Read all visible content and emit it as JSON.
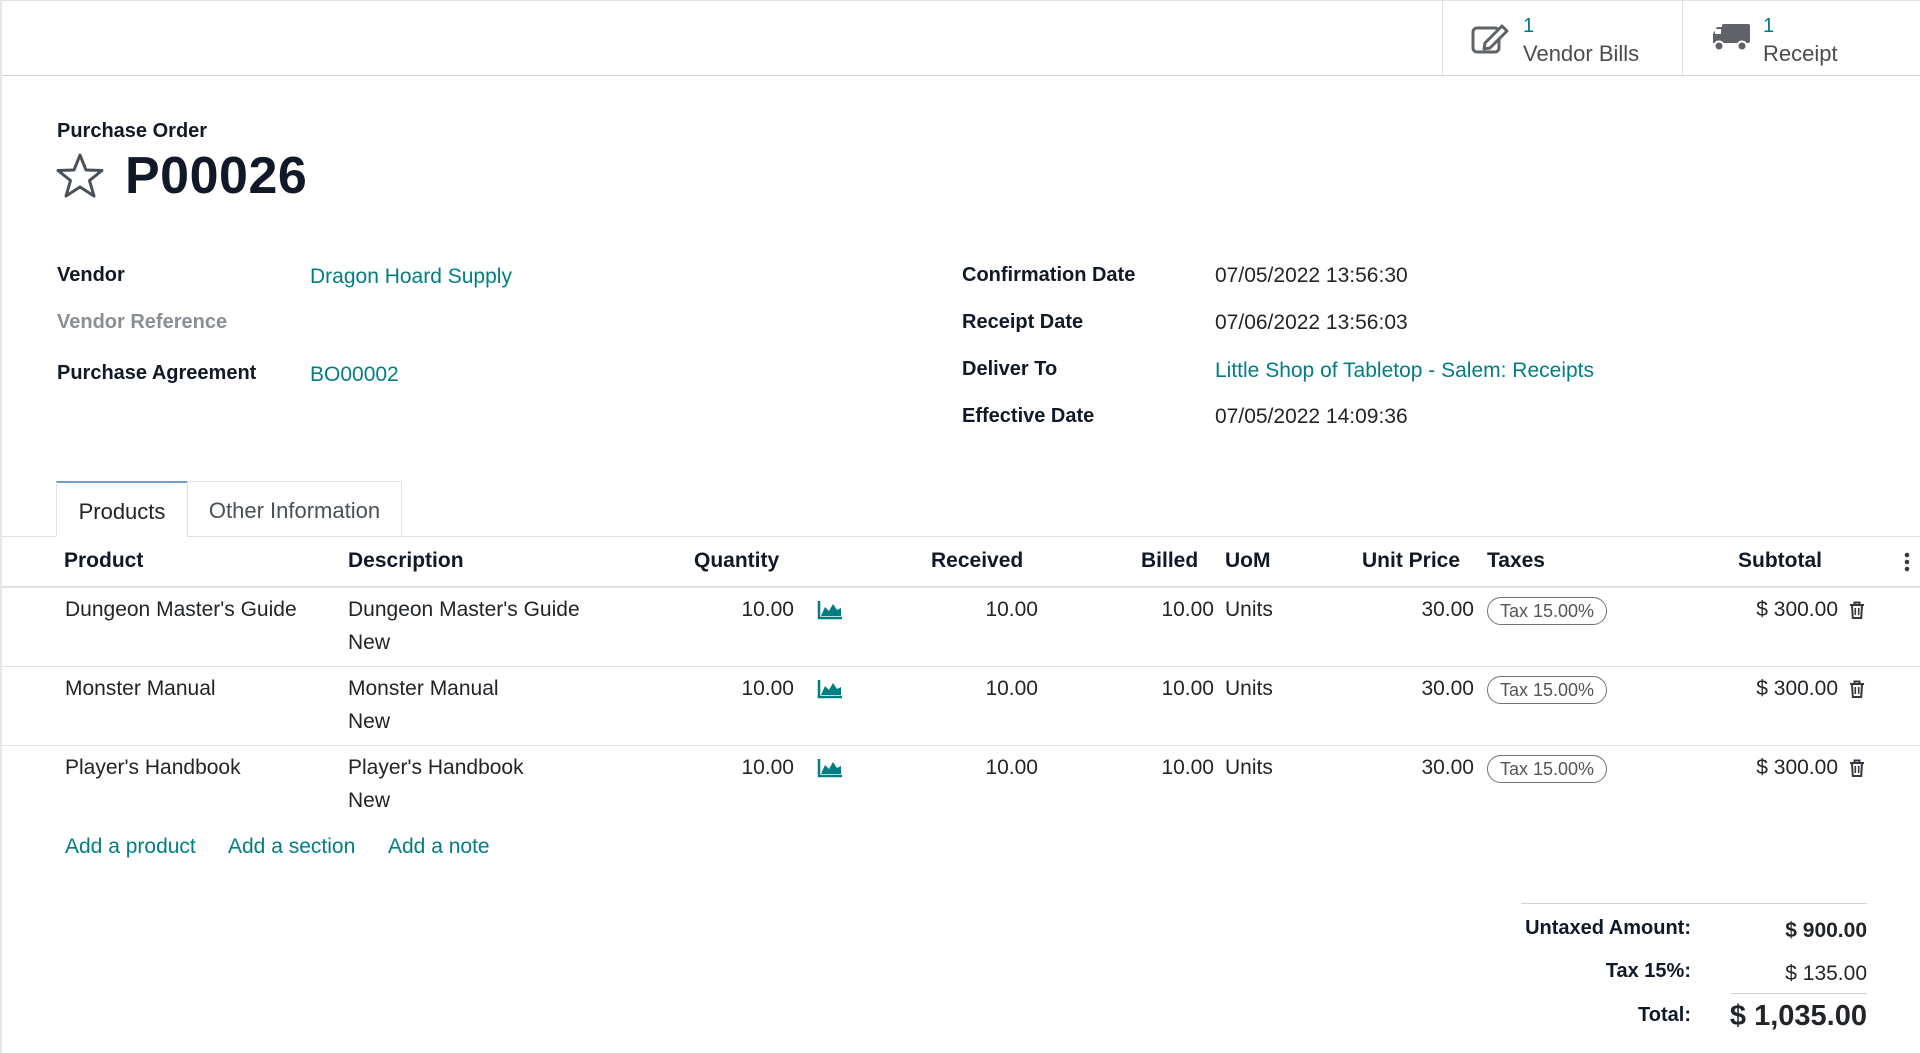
{
  "smart_buttons": [
    {
      "count": "1",
      "label": "Vendor Bills",
      "icon": "pencil-square-icon"
    },
    {
      "count": "1",
      "label": "Receipt",
      "icon": "truck-icon"
    }
  ],
  "document": {
    "type_label": "Purchase Order",
    "name": "P00026",
    "favorite_icon": "star-outline-icon"
  },
  "fields_left": [
    {
      "label": "Vendor",
      "value": "Dragon Hoard Supply"
    },
    {
      "label": "Vendor Reference",
      "value": ""
    },
    {
      "label": "Purchase Agreement",
      "value": "BO00002"
    }
  ],
  "fields_right": [
    {
      "label": "Confirmation Date",
      "value": "07/05/2022 13:56:30"
    },
    {
      "label": "Receipt Date",
      "value": "07/06/2022 13:56:03"
    },
    {
      "label": "Deliver To",
      "value": "Little Shop of Tabletop - Salem: Receipts"
    },
    {
      "label": "Effective Date",
      "value": "07/05/2022 14:09:36"
    }
  ],
  "tabs": [
    {
      "label": "Products",
      "active": true
    },
    {
      "label": "Other Information",
      "active": false
    }
  ],
  "table": {
    "columns": [
      "Product",
      "Description",
      "Quantity",
      "Received",
      "Billed",
      "UoM",
      "Unit Price",
      "Taxes",
      "Subtotal"
    ],
    "rows": [
      {
        "product": "Dungeon Master's Guide",
        "description_line1": "Dungeon Master's Guide",
        "description_line2": "New",
        "quantity": "10.00",
        "received": "10.00",
        "billed": "10.00",
        "uom": "Units",
        "unit_price": "30.00",
        "tax": "Tax 15.00%",
        "subtotal": "$ 300.00"
      },
      {
        "product": "Monster Manual",
        "description_line1": "Monster Manual",
        "description_line2": "New",
        "quantity": "10.00",
        "received": "10.00",
        "billed": "10.00",
        "uom": "Units",
        "unit_price": "30.00",
        "tax": "Tax 15.00%",
        "subtotal": "$ 300.00"
      },
      {
        "product": "Player's Handbook",
        "description_line1": "Player's Handbook",
        "description_line2": "New",
        "quantity": "10.00",
        "received": "10.00",
        "billed": "10.00",
        "uom": "Units",
        "unit_price": "30.00",
        "tax": "Tax 15.00%",
        "subtotal": "$ 300.00"
      }
    ],
    "add_links": [
      "Add a product",
      "Add a section",
      "Add a note"
    ]
  },
  "totals": {
    "untaxed_label": "Untaxed Amount:",
    "untaxed_value": "$ 900.00",
    "tax_label": "Tax 15%:",
    "tax_value": "$ 135.00",
    "total_label": "Total:",
    "total_value": "$ 1,035.00"
  },
  "colors": {
    "link": "#017e84",
    "heading": "#111827",
    "border": "#dee2e6"
  }
}
